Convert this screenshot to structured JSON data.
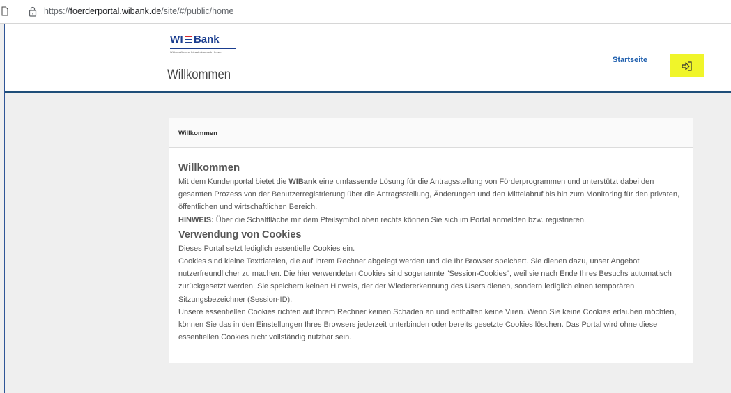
{
  "browser": {
    "url_prefix": "https://",
    "url_host": "foerderportal.wibank.de",
    "url_path": "/site/#/public/home"
  },
  "header": {
    "logo_text_left": "WI",
    "logo_text_right": "Bank",
    "logo_subtitle": "Wirtschafts- und Infrastrukturbank Hessen",
    "nav_startseite": "Startseite",
    "login_icon": "login-arrow-icon",
    "login_highlight_color": "#f0f52a",
    "page_title": "Willkommen"
  },
  "panel": {
    "header": "Willkommen",
    "heading_welcome": "Willkommen",
    "intro_before": "Mit dem Kundenportal bietet die ",
    "intro_brand": "WIBank",
    "intro_after": " eine umfassende Lösung für die Antragsstellung von Förderprogrammen und unterstützt dabei den gesamten Prozess von der Benutzerregistrierung über die Antragsstellung, Änderungen und den Mittelabruf bis hin zum Monitoring für den privaten, öffentlichen und wirtschaftlichen Bereich.",
    "hint_label": "HINWEIS:",
    "hint_text": " Über die Schaltfläche mit dem Pfeilsymbol oben rechts können Sie sich im Portal anmelden bzw. registrieren.",
    "heading_cookies": "Verwendung von Cookies",
    "cookies_line1": "Dieses Portal setzt lediglich essentielle Cookies ein.",
    "cookies_para2": "Cookies sind kleine Textdateien, die auf Ihrem Rechner abgelegt werden und die Ihr Browser speichert. Sie dienen dazu, unser Angebot nutzerfreundlicher zu machen. Die hier verwendeten Cookies sind sogenannte \"Session-Cookies\", weil sie nach Ende Ihres Besuchs automatisch zurückgesetzt werden. Sie speichern keinen Hinweis, der der Wiedererkennung des Users dienen, sondern lediglich einen temporären Sitzungsbezeichner (Session-ID).",
    "cookies_para3": "Unsere essentiellen Cookies richten auf Ihrem Rechner keinen Schaden an und enthalten keine Viren. Wenn Sie keine Cookies erlauben möchten, können Sie das in den Einstellungen Ihres Browsers jederzeit unterbinden oder bereits gesetzte Cookies löschen. Das Portal wird ohne diese essentiellen Cookies nicht vollständig nutzbar sein."
  }
}
